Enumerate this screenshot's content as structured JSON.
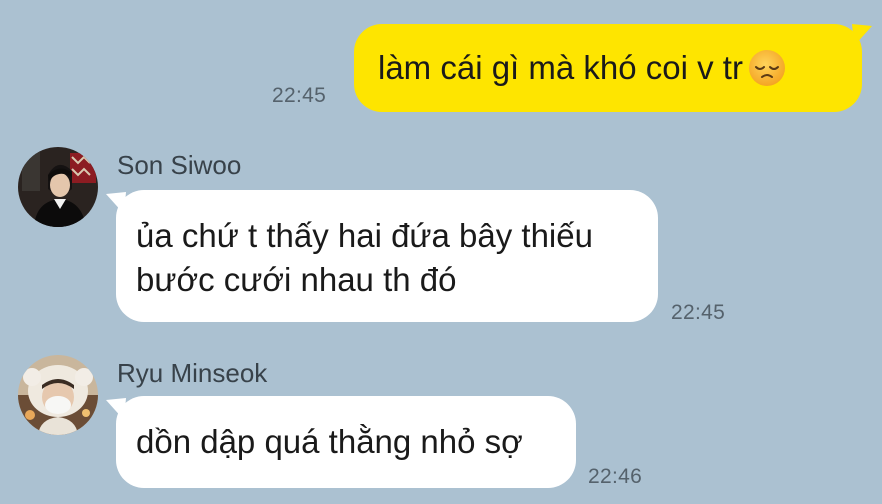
{
  "colors": {
    "background": "#abc1d1",
    "outgoing_bubble": "#fee500",
    "incoming_bubble": "#ffffff"
  },
  "messages": [
    {
      "direction": "outgoing",
      "text": "làm cái gì mà khó coi v tr",
      "emoji": "disappointed-face-icon",
      "time": "22:45"
    },
    {
      "direction": "incoming",
      "sender": "Son Siwoo",
      "avatar": "avatar-son-siwoo",
      "lines": [
        "ủa chứ t thấy hai đứa bây thiếu",
        "bước cưới nhau th đó"
      ],
      "time": "22:45"
    },
    {
      "direction": "incoming",
      "sender": "Ryu Minseok",
      "avatar": "avatar-ryu-minseok",
      "text": "dồn dập quá thằng nhỏ sợ",
      "time": "22:46"
    }
  ]
}
